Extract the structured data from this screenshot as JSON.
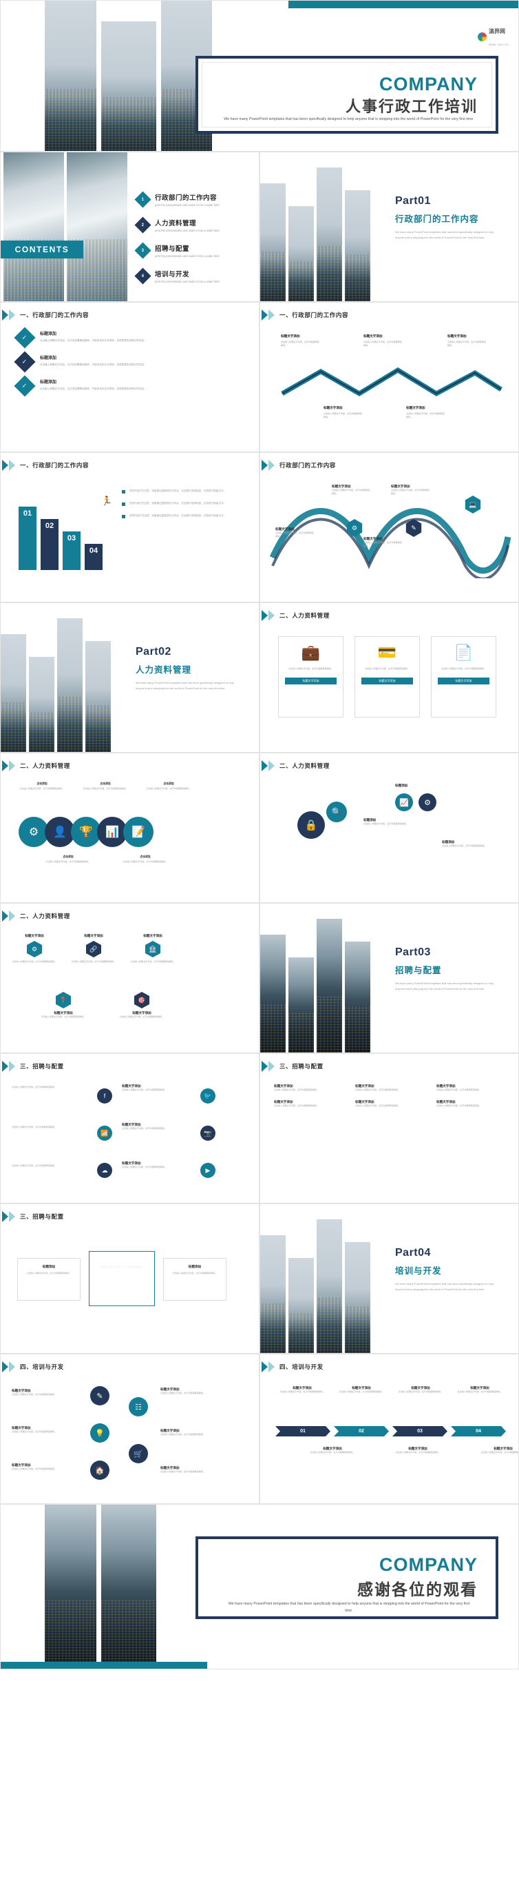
{
  "meta": {
    "brand_teal": "#137e96",
    "brand_navy": "#24385a",
    "watermark_text": "演界网",
    "watermark_sub": "WWW.YANJ.CN"
  },
  "cover": {
    "title_en": "COMPANY",
    "title_cn": "人事行政工作培训",
    "desc_line1": "We have many PowerPoint templates that has been specifically designed to help",
    "desc_line2": "anyone that is stepping into the world of PowerPoint for the very first time."
  },
  "contents": {
    "badge": "CONTENTS",
    "items": [
      {
        "num": "1",
        "title": "行政部门的工作内容",
        "sub": "print the presentation and make it into a wider field"
      },
      {
        "num": "2",
        "title": "人力资料管理",
        "sub": "print the presentation and make it into a wider field"
      },
      {
        "num": "3",
        "title": "招聘与配置",
        "sub": "print the presentation and make it into a wider field"
      },
      {
        "num": "4",
        "title": "培训与开发",
        "sub": "print the presentation and make it into a wider field"
      }
    ]
  },
  "parts": [
    {
      "num": "Part01",
      "cn": "行政部门的工作内容",
      "en": "We have many PowerPoint templates that has been specifically designed to help anyone that is stepping into the world of PowerPoint for the very first time."
    },
    {
      "num": "Part02",
      "cn": "人力资料管理",
      "en": "We have many PowerPoint templates that has been specifically designed to help anyone that is stepping into the world of PowerPoint for the very first time."
    },
    {
      "num": "Part03",
      "cn": "招聘与配置",
      "en": "We have many PowerPoint templates that has been specifically designed to help anyone that is stepping into the world of PowerPoint for the very first time."
    },
    {
      "num": "Part04",
      "cn": "培训与开发",
      "en": "We have many PowerPoint templates that has been specifically designed to help anyone that is stepping into the world of PowerPoint for the very first time."
    }
  ],
  "section_headers": {
    "h1": "一、行政部门的工作内容",
    "h1b": "一、行政部门的工作内容",
    "h1c": "一、行政部门的工作内容",
    "h1d": "行政部门的工作内容",
    "h2": "二、人力资料管理",
    "h2b": "二、人力资料管理",
    "h2c": "二、人力资料管理",
    "h2d": "二、人力资料管理",
    "h3": "三、招聘与配置",
    "h3b": "三、招聘与配置",
    "h3c": "三、招聘与配置",
    "h4": "四、培训与开发",
    "h4b": "四、培训与开发"
  },
  "placeholders": {
    "title_add": "标题添加",
    "title_text_add": "标题文字添加",
    "text_add": "添加标题文字",
    "body_short": "点击输入简要文字内容，文字内容需概括精炼，不用多余的文字修饰，言简意赅的说明分项内容。",
    "body_med": "点击输入简要文字内容，文字内容需概括精炼，不用多余的文字修饰，言简意赅的说明分项内容。",
    "body_tiny": "点击输入简要文字内容，文字内容需概括精炼。",
    "click_add": "点击添加",
    "btn": "标题文字添加"
  },
  "slide_numbered": {
    "numbers": [
      "01",
      "02",
      "03",
      "04"
    ],
    "lines": [
      "您的内容打在这里，或者通过复制您的文本后，在此框中选择粘贴，并选择只保留文字。",
      "您的内容打在这里，或者通过复制您的文本后，在此框中选择粘贴，并选择只保留文字。",
      "您的内容打在这里，或者通过复制您的文本后，在此框中选择粘贴，并选择只保留文字。"
    ]
  },
  "slide_arrows": {
    "labels": [
      "01",
      "02",
      "03",
      "04"
    ],
    "titles": [
      "标题文字添加",
      "标题文字添加",
      "标题文字添加",
      "标题文字添加"
    ]
  },
  "ending": {
    "title_en": "COMPANY",
    "title_cn": "感谢各位的观看",
    "desc_line1": "We have many PowerPoint templates that has been specifically designed to help",
    "desc_line2": "anyone that is stepping into the world of PowerPoint for the very first time."
  }
}
